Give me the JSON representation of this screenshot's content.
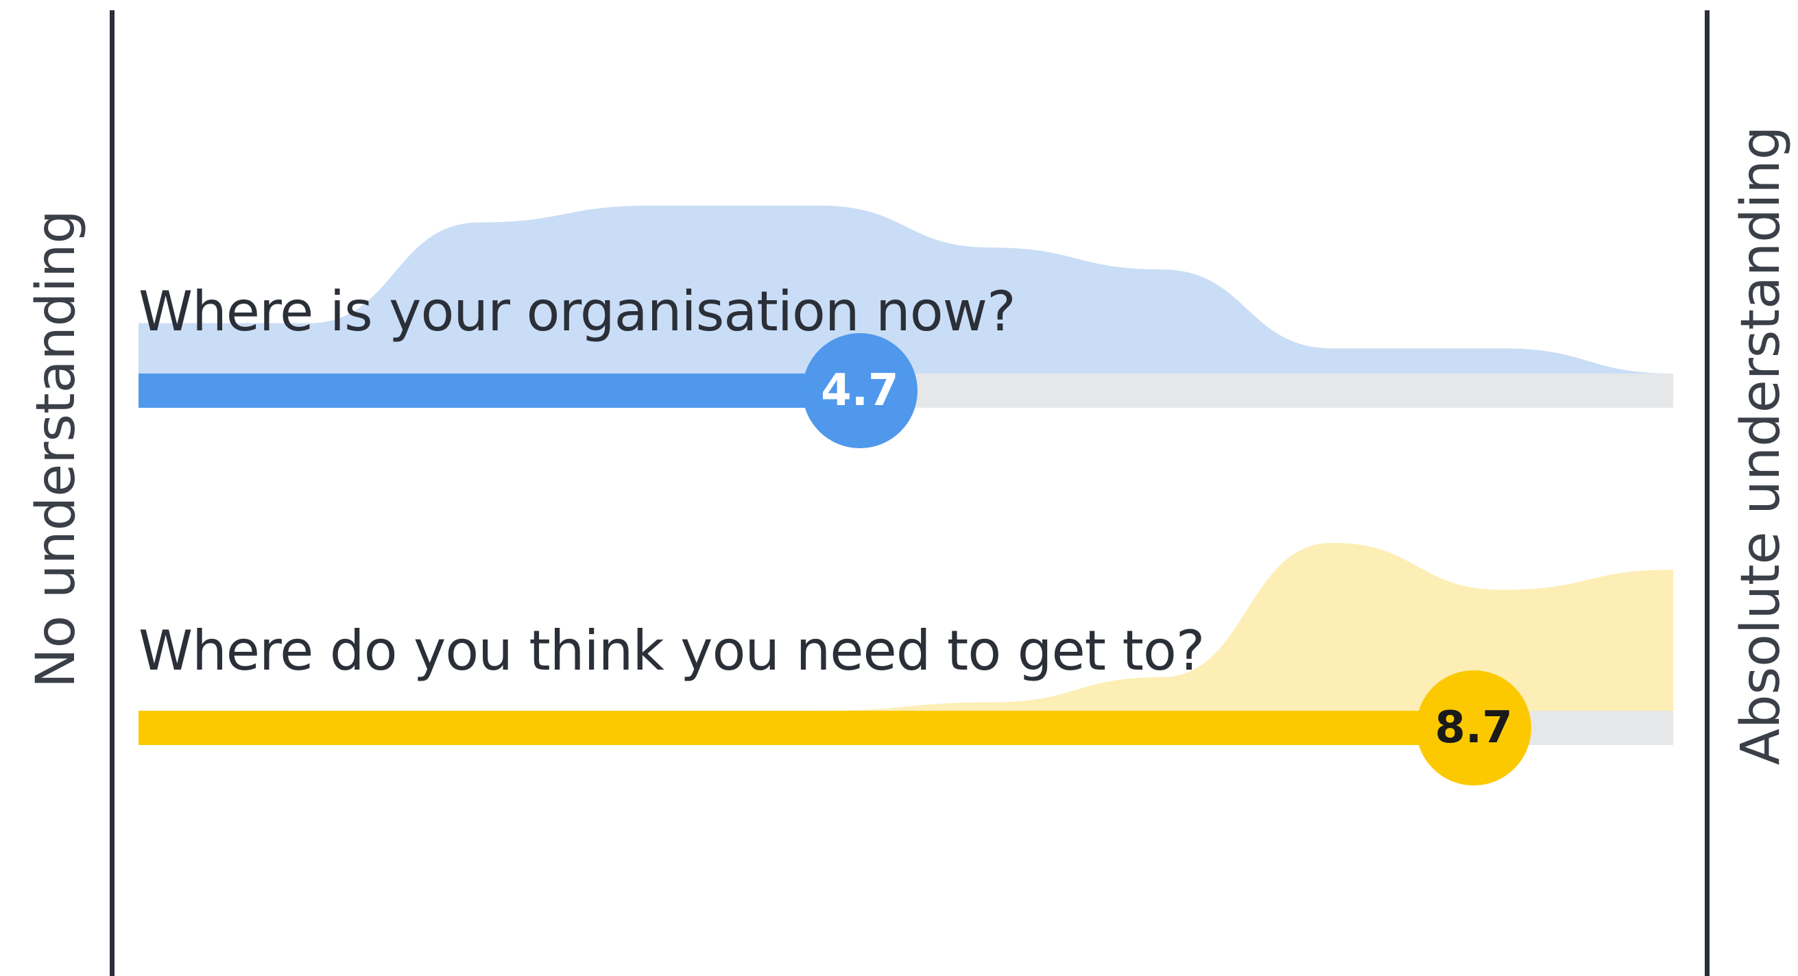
{
  "scale": {
    "min": 0,
    "max": 10,
    "left_label": "No understanding",
    "right_label": "Absolute understanding"
  },
  "questions": [
    {
      "label": "Where is your organisation now?",
      "value": 4.7,
      "value_text": "4.7",
      "color": "#4f98ec",
      "dist_color": "#c9ddf6",
      "knob_text_color": "#ffffff",
      "distribution": [
        0.3,
        0.3,
        0.9,
        1.0,
        1.0,
        0.75,
        0.62,
        0.15,
        0.15,
        0.0
      ]
    },
    {
      "label": "Where do you think you need to get to?",
      "value": 8.7,
      "value_text": "8.7",
      "color": "#fcc900",
      "dist_color": "#fdeeb5",
      "knob_text_color": "#1a1a1a",
      "distribution": [
        0.0,
        0.0,
        0.0,
        0.0,
        0.0,
        0.05,
        0.2,
        1.0,
        0.72,
        0.84
      ]
    }
  ],
  "colors": {
    "axis": "#2a2f3a",
    "track": "#e6e7e9",
    "text": "#2b2f38"
  }
}
